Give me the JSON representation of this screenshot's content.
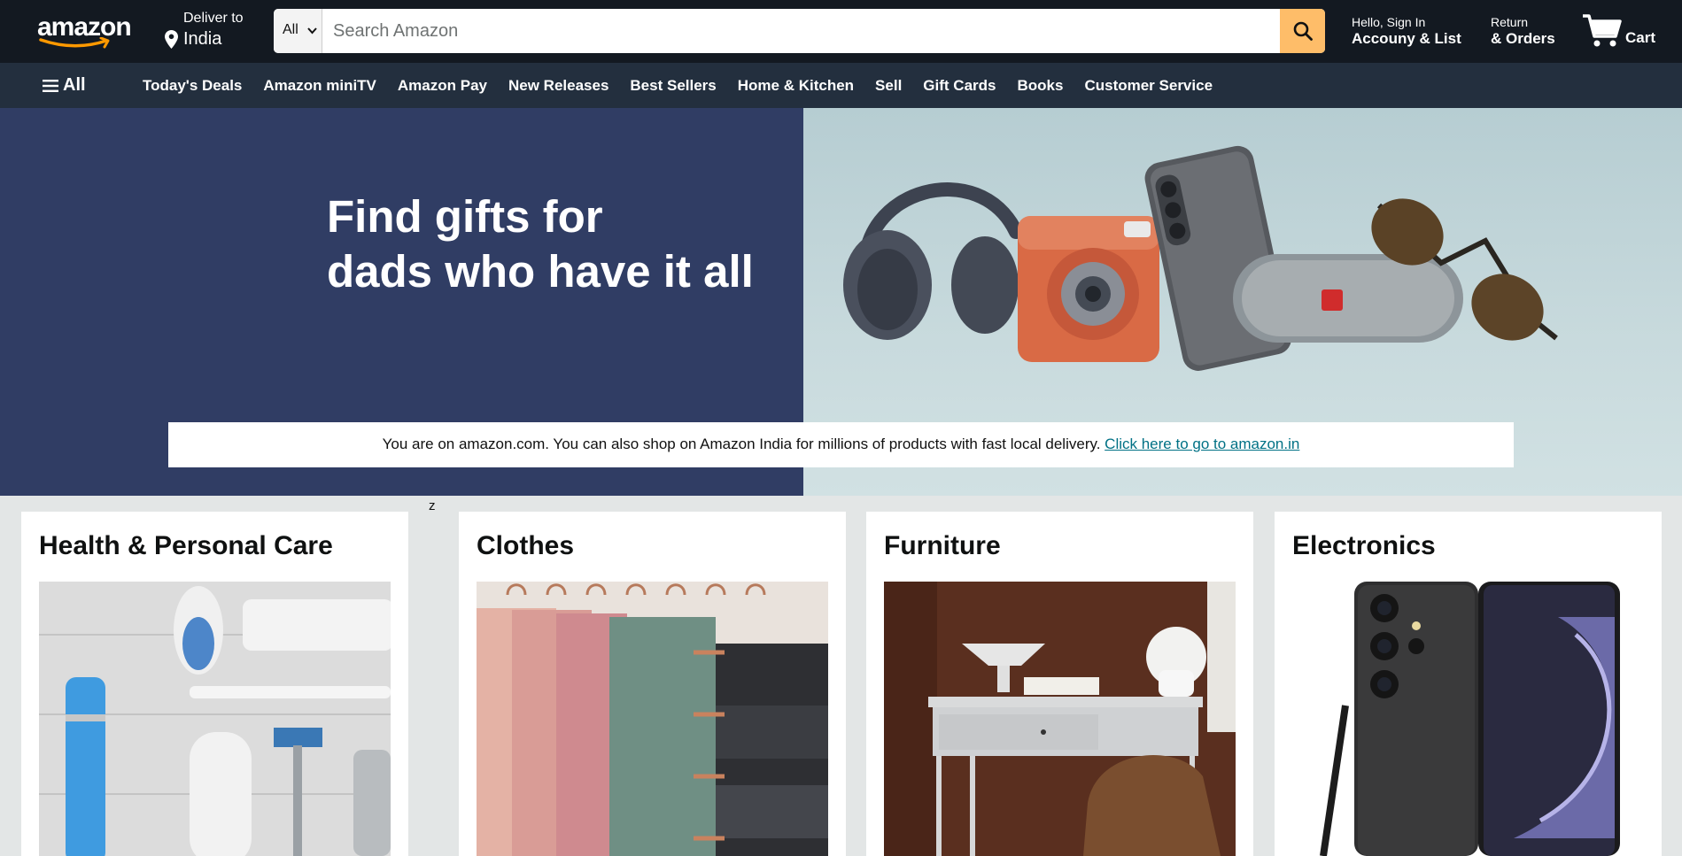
{
  "header": {
    "logo_text": "amazon",
    "deliver_label": "Deliver to",
    "deliver_location": "India",
    "search_category": "All",
    "search_placeholder": "Search Amazon",
    "account_greeting": "Hello, Sign In",
    "account_label": "Accouny & List",
    "returns_label": "Return",
    "orders_label": "& Orders",
    "cart_label": "Cart",
    "brand_color": "#131921",
    "accent_color": "#febd69"
  },
  "subnav": {
    "all_label": "All",
    "links": [
      "Today's Deals",
      "Amazon miniTV",
      "Amazon Pay",
      "New Releases",
      "Best Sellers",
      "Home & Kitchen",
      "Sell",
      "Gift Cards",
      "Books",
      "Customer Service"
    ]
  },
  "hero": {
    "headline_line1": "Find gifts for",
    "headline_line2": "dads who have it all",
    "notice_text": "You are on amazon.com. You can also shop on Amazon India for millions of products with fast local delivery.",
    "notice_link": "Click here to go to amazon.in"
  },
  "stray_char": "z",
  "cards": [
    {
      "title": "Health & Personal Care"
    },
    {
      "title": "Clothes"
    },
    {
      "title": "Furniture"
    },
    {
      "title": "Electronics"
    }
  ]
}
